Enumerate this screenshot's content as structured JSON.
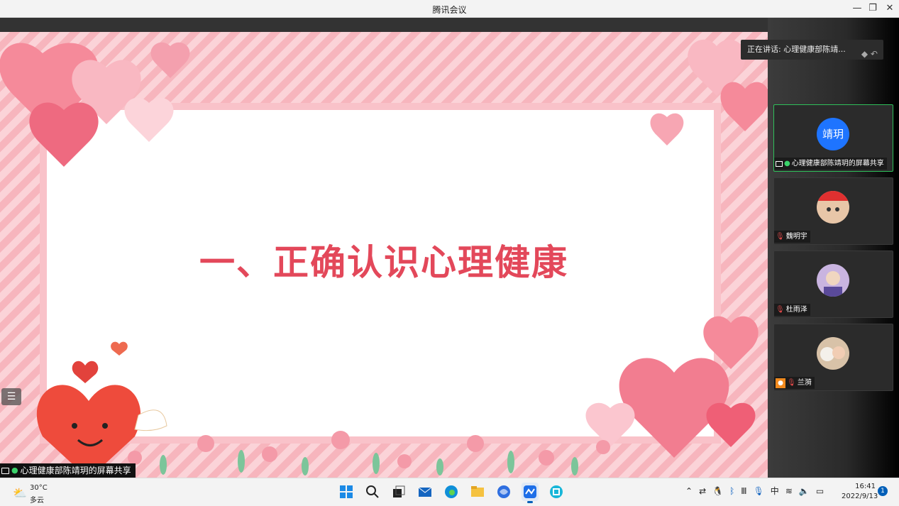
{
  "window": {
    "title": "腾讯会议",
    "min_icon": "minimize-icon",
    "max_icon": "restore-icon",
    "close_icon": "close-icon"
  },
  "slide": {
    "title": "一、正确认识心理健康"
  },
  "share_label": "心理健康部陈靖玥的屏幕共享",
  "speaking": {
    "text": "正在讲话: 心理健康部陈靖...",
    "icon": "collapse-arrow-icon"
  },
  "participants": [
    {
      "avatar_text": "靖玥",
      "label": "心理健康部陈靖玥的屏幕共享",
      "active": true
    },
    {
      "avatar_text": "",
      "label": "魏明宇",
      "active": false
    },
    {
      "avatar_text": "",
      "label": "杜雨泽",
      "active": false
    },
    {
      "avatar_text": "",
      "label": "兰漪",
      "active": false
    }
  ],
  "taskbar": {
    "weather": {
      "temp": "30°C",
      "condition": "多云"
    },
    "apps": [
      "start-icon",
      "search-icon",
      "task-view-icon",
      "mail-icon",
      "edge-icon",
      "file-explorer-icon",
      "browser-icon",
      "tencent-meeting-icon",
      "notes-icon"
    ],
    "tray": {
      "ime": "中"
    },
    "clock": {
      "time": "16:41",
      "date": "2022/9/13"
    },
    "notifications": "1"
  },
  "colors": {
    "accent": "#1e74ff",
    "slide_title": "#e3485a",
    "active_border": "#2fbf5a"
  }
}
